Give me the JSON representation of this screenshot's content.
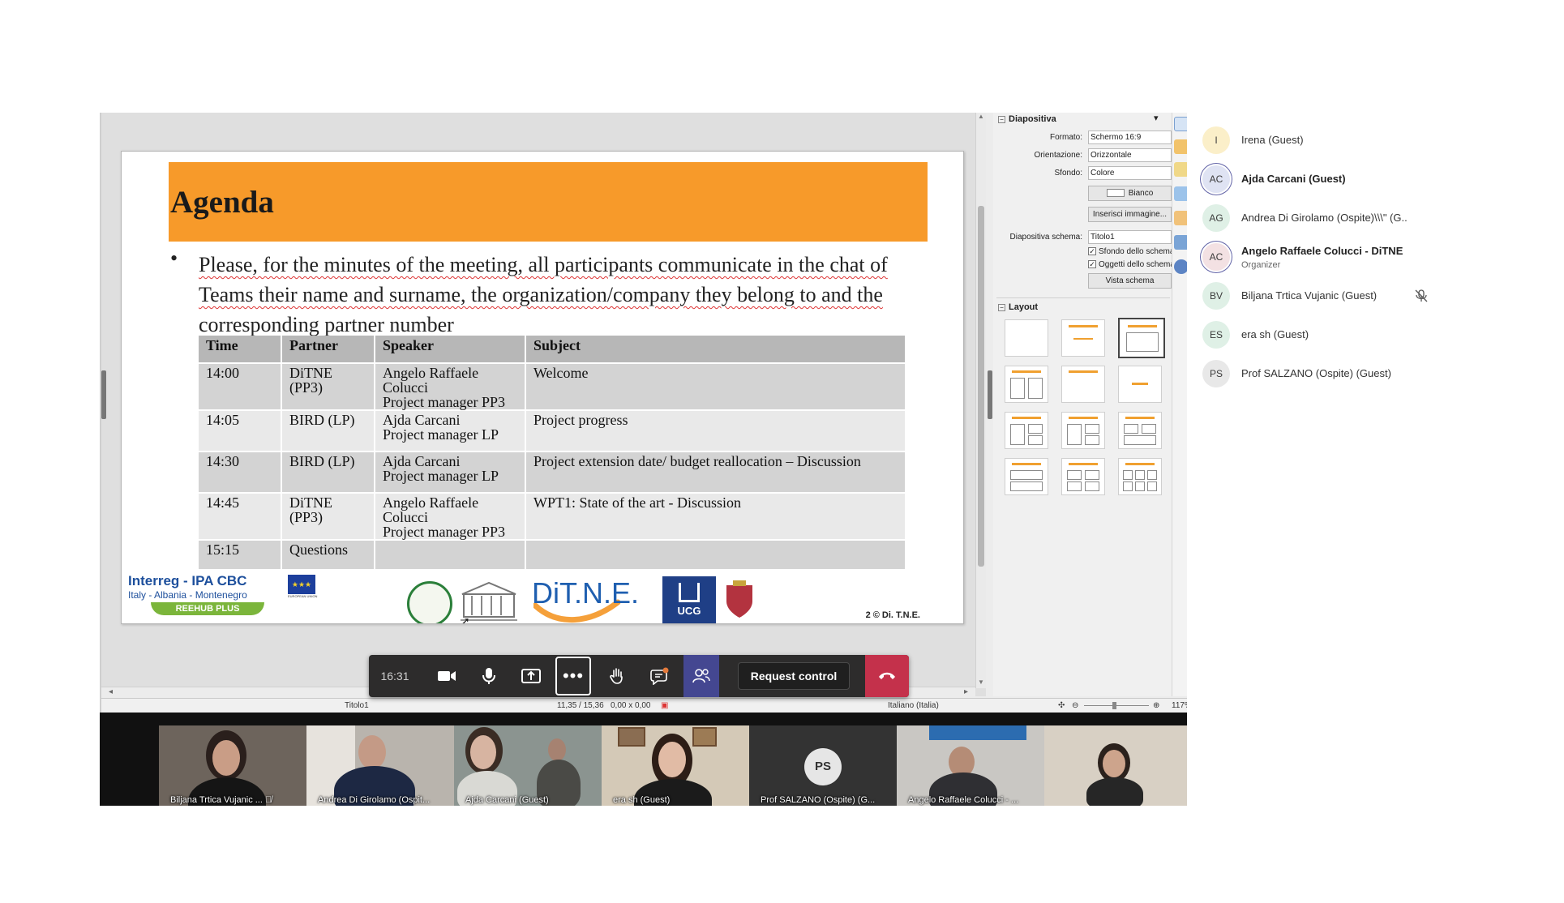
{
  "slide": {
    "title": "Agenda",
    "bullet": "Please,  for the minutes of the meeting, all participants communicate in the chat of Teams their name and surname, the organization/company they belong to and the corresponding partner number",
    "table": {
      "headers": [
        "Time",
        "Partner",
        "Speaker",
        "Subject"
      ],
      "rows": [
        {
          "time": "14:00",
          "partner": "DiTNE (PP3)",
          "speaker1": "Angelo Raffaele Colucci",
          "speaker2": "Project manager PP3",
          "subject": "Welcome"
        },
        {
          "time": "14:05",
          "partner": "BIRD (LP)",
          "speaker1": "Ajda Carcani",
          "speaker2": "Project manager LP",
          "subject": "Project progress"
        },
        {
          "time": "14:30",
          "partner": "BIRD (LP)",
          "speaker1": "Ajda Carcani",
          "speaker2": "Project manager LP",
          "subject": "Project extension date/ budget reallocation – Discussion"
        },
        {
          "time": "14:45",
          "partner": "DiTNE (PP3)",
          "speaker1": "Angelo Raffaele Colucci",
          "speaker2": "Project manager PP3",
          "subject": "WPT1: State of the art - Discussion"
        },
        {
          "time": "15:15",
          "partner": "Questions",
          "speaker1": "",
          "speaker2": "",
          "subject": ""
        }
      ]
    },
    "logos": {
      "interreg_title": "Interreg - IPA CBC",
      "interreg_sub": "Italy - Albania - Montenegro",
      "interreg_bar": "REEHUB PLUS",
      "eu_label": "EUROPEAN UNION",
      "ditne": "DiT.N.E.",
      "ucg": "UCG",
      "slide_number": "2 © Di. T.N.E."
    }
  },
  "properties": {
    "slide_section": "Diapositiva",
    "fields": [
      {
        "label": "Formato:",
        "value": "Schermo 16:9"
      },
      {
        "label": "Orientazione:",
        "value": "Orizzontale"
      },
      {
        "label": "Sfondo:",
        "value": "Colore"
      }
    ],
    "color_button": "Bianco",
    "insert_image_button": "Inserisci immagine...",
    "master_label": "Diapositiva schema:",
    "master_value": "Titolo1",
    "check_bg": "Sfondo dello schema",
    "check_objects": "Oggetti dello schema",
    "master_view_button": "Vista schema",
    "layout_section": "Layout"
  },
  "statusbar": {
    "slide_name": "Titolo1",
    "position": "11,35 / 15,36",
    "size": "0,00 x 0,00",
    "language": "Italiano (Italia)",
    "zoom": "117%"
  },
  "call_controls": {
    "time": "16:31",
    "request_control": "Request control"
  },
  "gallery": [
    {
      "name": "Biljana Trtica Vujanic ...",
      "muted": true
    },
    {
      "name": "Andrea Di Girolamo (Ospit..."
    },
    {
      "name": "Ajda Carcani (Guest)"
    },
    {
      "name": "era sh (Guest)"
    },
    {
      "name": "Prof SALZANO (Ospite) (G...",
      "initials": "PS"
    },
    {
      "name": "Angelo Raffaele Colucci - ..."
    },
    {
      "name": ""
    }
  ],
  "participants": [
    {
      "initials": "I",
      "name": "Irena (Guest)",
      "color": "#fbefc9"
    },
    {
      "initials": "AC",
      "name": "Ajda Carcani (Guest)",
      "color": "#dfe3f3",
      "bold": true
    },
    {
      "initials": "AG",
      "name": "Andrea Di Girolamo (Ospite)\\\\\\\" (G..",
      "color": "#dff0e6"
    },
    {
      "initials": "AC",
      "name": "Angelo Raffaele Colucci - DiTNE",
      "role": "Organizer",
      "color": "#f3e1e3",
      "bold": true
    },
    {
      "initials": "BV",
      "name": "Biljana Trtica Vujanic (Guest)",
      "color": "#dff0e6",
      "muted": true
    },
    {
      "initials": "ES",
      "name": "era sh (Guest)",
      "color": "#dff0e6"
    },
    {
      "initials": "PS",
      "name": "Prof SALZANO (Ospite) (Guest)",
      "color": "#e8e8e8"
    }
  ],
  "colors": {
    "slide_header": "#f79a2a",
    "hangup": "#c4314b",
    "teams_accent": "#444791"
  }
}
